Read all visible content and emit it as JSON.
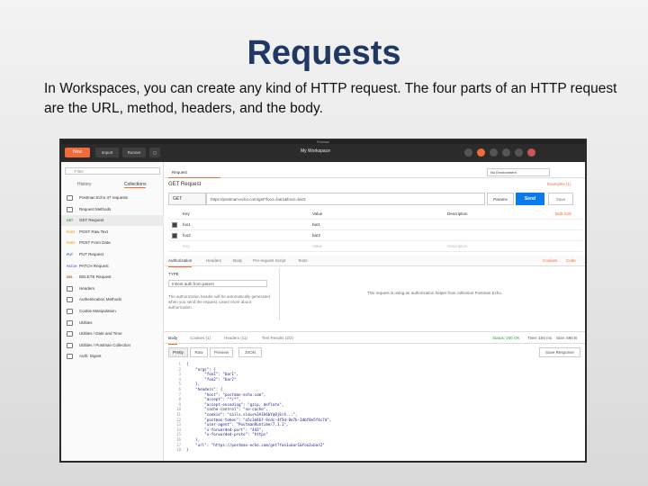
{
  "slide": {
    "title": "Requests",
    "body": "In Workspaces, you can create any kind of HTTP request. The four parts of an HTTP request are the URL, method, headers, and the body."
  },
  "window": {
    "title": "Postman"
  },
  "toolbar": {
    "new_label": "New",
    "import_label": "Import",
    "runner_label": "Runner",
    "workspace_label": "My Workspace"
  },
  "sidebar": {
    "filter_placeholder": "Filter",
    "tabs": [
      "History",
      "Collections"
    ],
    "items": [
      {
        "method": "",
        "label": "Postman Echo",
        "kind": "folder",
        "sub": "37 requests"
      },
      {
        "method": "",
        "label": "Request Methods",
        "kind": "folder"
      },
      {
        "method": "GET",
        "label": "GET Request",
        "kind": "req",
        "selected": true
      },
      {
        "method": "POST",
        "label": "POST Raw Text",
        "kind": "req"
      },
      {
        "method": "POST",
        "label": "POST Form Data",
        "kind": "req"
      },
      {
        "method": "PUT",
        "label": "PUT Request",
        "kind": "req"
      },
      {
        "method": "PATCH",
        "label": "PATCH Request",
        "kind": "req"
      },
      {
        "method": "DEL",
        "label": "DELETE Request",
        "kind": "req"
      },
      {
        "method": "",
        "label": "Headers",
        "kind": "folder"
      },
      {
        "method": "",
        "label": "Authentication Methods",
        "kind": "folder"
      },
      {
        "method": "",
        "label": "Cookie Manipulation",
        "kind": "folder"
      },
      {
        "method": "",
        "label": "Utilities",
        "kind": "folder"
      },
      {
        "method": "",
        "label": "Utilities / Date and Time",
        "kind": "folder"
      },
      {
        "method": "",
        "label": "Utilities / Postman Collection",
        "kind": "folder"
      },
      {
        "method": "",
        "label": "Auth: Digest",
        "kind": "folder"
      }
    ]
  },
  "request": {
    "tab_label": "Request",
    "title": "GET Request",
    "method": "GET",
    "url": "https://postman-echo.com/get?foo1=bar1&foo2=bar2",
    "params_label": "Params",
    "send_label": "Send",
    "save_label": "Save",
    "env_label": "No Environment",
    "examples_label": "Examples (1)"
  },
  "params_table": {
    "headers": [
      "Key",
      "Value",
      "Description"
    ],
    "rows": [
      [
        "foo1",
        "bar1",
        ""
      ],
      [
        "foo2",
        "bar2",
        ""
      ]
    ],
    "new_key": "Key",
    "new_value": "Value",
    "new_desc": "Description",
    "bulk_edit": "Bulk Edit"
  },
  "auth": {
    "tabs": [
      "Authorization",
      "Headers",
      "Body",
      "Pre-request Script",
      "Tests"
    ],
    "type_label": "TYPE",
    "type_value": "Inherit auth from parent",
    "note": "The authorization header will be automatically generated when you send the request. Learn more about authorization",
    "message": "This request is using an authorization helper from collection Postman Echo.",
    "cookies": "Cookies",
    "code": "Code"
  },
  "response": {
    "tabs": [
      "Body",
      "Cookies (1)",
      "Headers (11)",
      "Test Results (2/2)"
    ],
    "status": "Status: 200 OK",
    "time": "Time: 194 ms",
    "size": "Size: 695 B",
    "formats": [
      "Pretty",
      "Raw",
      "Preview"
    ],
    "format_type": "JSON",
    "save_btn": "Save Response"
  },
  "code_lines": [
    "{",
    "    \"args\": {",
    "        \"foo1\": \"bar1\",",
    "        \"foo2\": \"bar2\"",
    "    },",
    "    \"headers\": {",
    "        \"host\": \"postman-echo.com\",",
    "        \"accept\": \"*/*\",",
    "        \"accept-encoding\": \"gzip, deflate\",",
    "        \"cache-control\": \"no-cache\",",
    "        \"cookie\": \"sails.sid=s%3A1k6bYq0jEr4...\",",
    "        \"postman-token\": \"a5c3d46f-9cdc-4f5d-8e7b-3dbf8e5f4c7d\",",
    "        \"user-agent\": \"PostmanRuntime/7.1.1\",",
    "        \"x-forwarded-port\": \"443\",",
    "        \"x-forwarded-proto\": \"https\"",
    "    },",
    "    \"url\": \"https://postman-echo.com/get?foo1=bar1&foo2=bar2\"",
    "}"
  ]
}
